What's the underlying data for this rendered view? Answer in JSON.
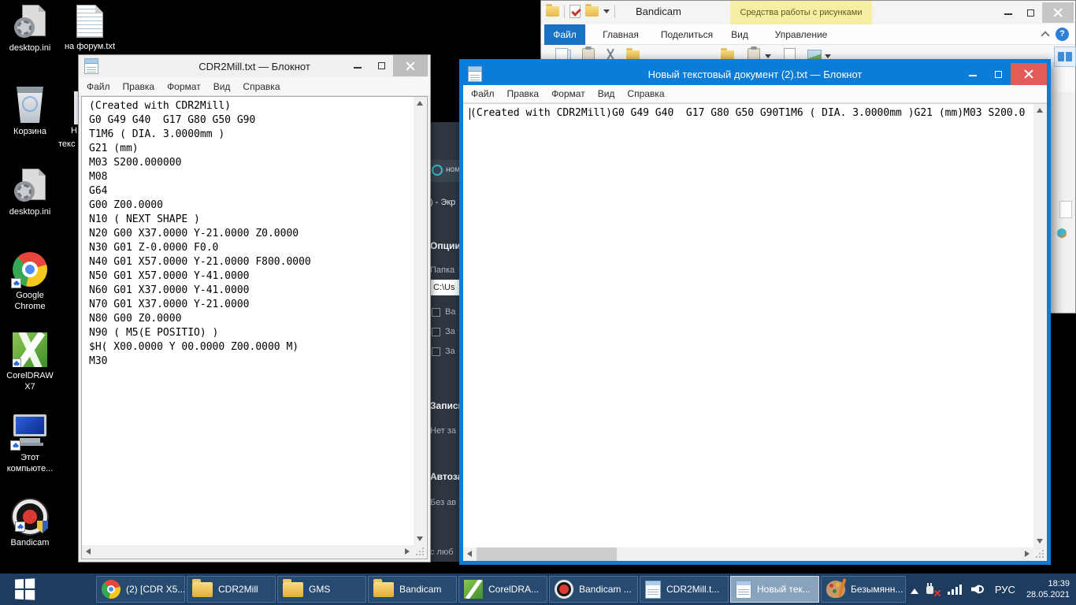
{
  "colors": {
    "accent_blue": "#0c7cd9",
    "close_red": "#e25c5a",
    "taskbar_bg": "#1d3c60",
    "context_tab_yellow": "#f5efa3",
    "folder_yellow": "#f1c858",
    "desktop_bg": "#000000"
  },
  "desktop": {
    "icons": [
      {
        "name": "desktop-ini-1",
        "label": "desktop.ini"
      },
      {
        "name": "na-forum-txt",
        "label": "на форум.txt"
      },
      {
        "name": "recycle-bin",
        "label": "Корзина"
      },
      {
        "name": "desktop-ini-2",
        "label": "desktop.ini"
      },
      {
        "name": "google-chrome",
        "label1": "Google",
        "label2": "Chrome"
      },
      {
        "name": "coreldraw-x7",
        "label1": "CorelDRAW",
        "label2": "X7"
      },
      {
        "name": "this-pc",
        "label1": "Этот",
        "label2": "компьюте..."
      },
      {
        "name": "bandicam",
        "label": "Bandicam"
      }
    ],
    "hidden_icon_fragments": {
      "line1": "Н",
      "line2": "текс"
    }
  },
  "notepad1": {
    "title": "CDR2Mill.txt — Блокнот",
    "menu": [
      "Файл",
      "Правка",
      "Формат",
      "Вид",
      "Справка"
    ],
    "content": "(Created with CDR2Mill)\nG0 G49 G40  G17 G80 G50 G90\nT1M6 ( DIA. 3.0000mm )\nG21 (mm)\nM03 S200.000000\nM08\nG64\nG00 Z00.0000\nN10 ( NEXT SHAPE )\nN20 G00 X37.0000 Y-21.0000 Z0.0000\nN30 G01 Z-0.0000 F0.0\nN40 G01 X57.0000 Y-21.0000 F800.0000\nN50 G01 X57.0000 Y-41.0000\nN60 G01 X37.0000 Y-41.0000\nN70 G01 X37.0000 Y-21.0000\nN80 G00 Z0.0000\nN90 ( M5(E POSITIO) )\n$H( X00.0000 Y 00.0000 Z00.0000 M)\nM30"
  },
  "notepad2": {
    "title": "Новый текстовый документ (2).txt — Блокнот",
    "menu": [
      "Файл",
      "Правка",
      "Формат",
      "Вид",
      "Справка"
    ],
    "content": "(Created with CDR2Mill)G0 G49 G40  G17 G80 G50 G90T1M6 ( DIA. 3.0000mm )G21 (mm)M03 S200.0"
  },
  "explorer": {
    "title": "Bandicam",
    "context_tab": "Средства работы с рисунками",
    "tabs": [
      "Файл",
      "Главная",
      "Поделиться",
      "Вид",
      "Управление"
    ],
    "help_label": "?"
  },
  "bandicam_app": {
    "home_tab": "ном",
    "screen_fragment": ") - Экр",
    "options_header": "Опции",
    "folder_label": "Папка",
    "path_value": "C:\\Us",
    "check1": "Ва",
    "check2": "За",
    "check3": "За",
    "record_header": "Запись",
    "record_status": "Нет за",
    "autostart_header": "Автоза",
    "autostart_status": "Без ав",
    "bottom_fragment": "с люб"
  },
  "taskbar": {
    "items": [
      {
        "label": "(2) [CDR X5...",
        "icon": "chrome-icon",
        "active": false
      },
      {
        "label": "CDR2Mill",
        "icon": "folder-icon",
        "active": false
      },
      {
        "label": "GMS",
        "icon": "folder-icon",
        "active": false
      },
      {
        "label": "Bandicam",
        "icon": "folder-icon",
        "active": false
      },
      {
        "label": "CorelDRA...",
        "icon": "coreldraw-icon",
        "active": false
      },
      {
        "label": "Bandicam ...",
        "icon": "bandicam-icon",
        "active": false
      },
      {
        "label": "CDR2Mill.t...",
        "icon": "notepad-icon",
        "active": false
      },
      {
        "label": "Новый тек...",
        "icon": "notepad-icon",
        "active": true
      },
      {
        "label": "Безымянн...",
        "icon": "paint-icon",
        "active": false
      }
    ],
    "tray": {
      "lang": "РУС",
      "time": "18:39",
      "date": "28.05.2021"
    }
  }
}
